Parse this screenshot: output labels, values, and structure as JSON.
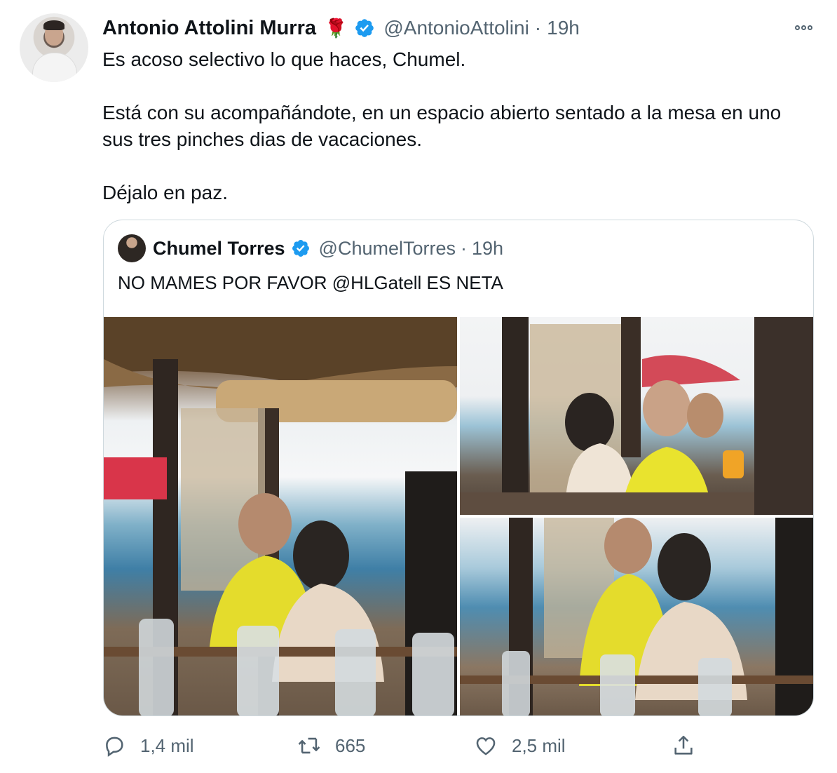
{
  "tweet": {
    "author_name": "Antonio Attolini Murra",
    "author_emoji": "🌹",
    "handle": "@AntonioAttolini",
    "separator": "·",
    "time": "19h",
    "lines": [
      "Es acoso selectivo lo que haces, Chumel.",
      "Está con su acompañándote, en un espacio abierto sentado a la mesa en uno sus tres pinches dias de vacaciones.",
      "Déjalo en paz."
    ]
  },
  "quoted": {
    "author_name": "Chumel Torres",
    "handle": "@ChumelTorres",
    "separator": "·",
    "time": "19h",
    "text": "NO MAMES POR FAVOR @HLGatell ES NETA"
  },
  "actions": {
    "reply_count": "1,4 mil",
    "retweet_count": "665",
    "like_count": "2,5 mil"
  },
  "icons": {
    "verified": "verified-badge-icon",
    "more": "more-options-icon",
    "reply": "reply-icon",
    "retweet": "retweet-icon",
    "like": "heart-icon",
    "share": "share-icon"
  },
  "colors": {
    "verified_blue": "#1d9bf0",
    "secondary_text": "#536471",
    "border": "#cfd9de"
  }
}
